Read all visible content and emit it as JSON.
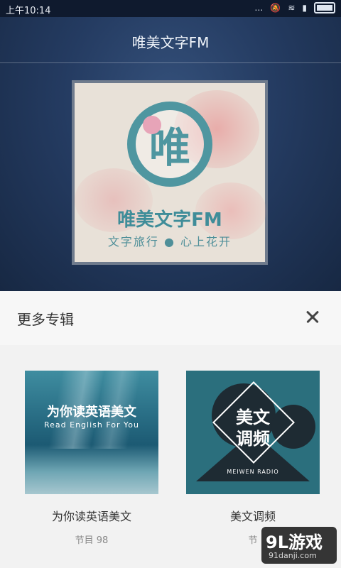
{
  "status_bar": {
    "time": "上午10:14"
  },
  "header": {
    "title": "唯美文字FM"
  },
  "cover": {
    "title": "唯美文字FM",
    "logo_char": "唯",
    "subtitle": "文字旅行 ● 心上花开"
  },
  "sheet": {
    "title": "更多专辑",
    "albums": [
      {
        "name": "为你读英语美文",
        "count": "节目 98",
        "thumb_title": "为你读英语美文",
        "thumb_sub": "Read English For You"
      },
      {
        "name": "美文调频",
        "count": "节",
        "thumb_line1": "美文",
        "thumb_line2": "调频",
        "thumb_sub": "MEIWEN RADIO"
      }
    ]
  },
  "watermark": {
    "brand": "9L游戏",
    "site": "91danji.com"
  },
  "icons": [
    "signal-icon",
    "mute-icon",
    "wifi-icon",
    "battery-icon",
    "close-icon"
  ]
}
